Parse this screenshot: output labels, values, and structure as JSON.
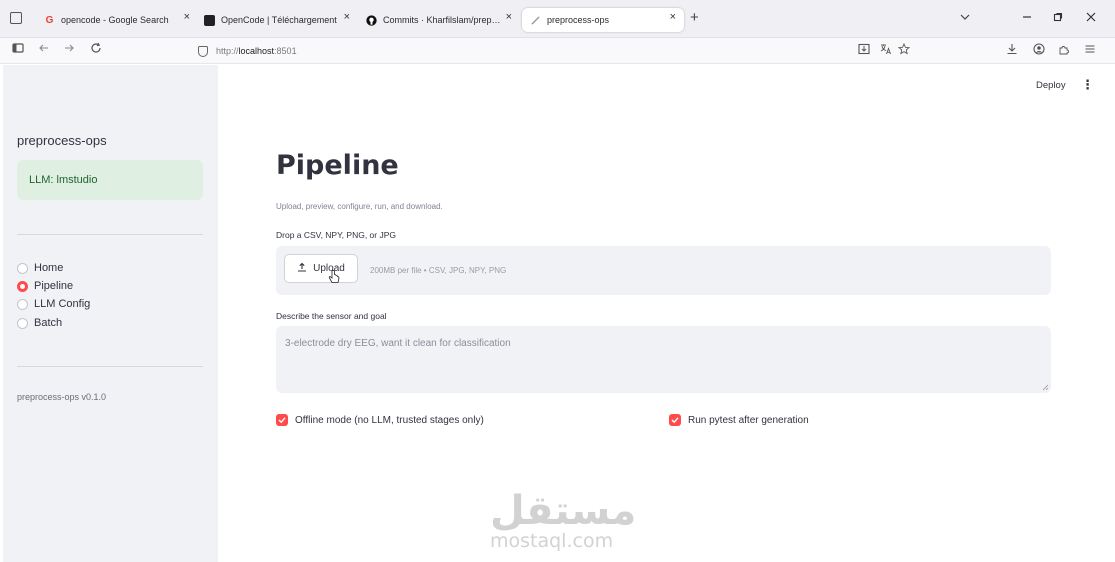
{
  "browser": {
    "tabs": [
      {
        "label": "opencode - Google Search",
        "favicon": "google-icon",
        "favicon_text": "G",
        "active": false
      },
      {
        "label": "OpenCode | Téléchargement",
        "favicon": "opencode-icon",
        "favicon_text": "",
        "active": false
      },
      {
        "label": "Commits · Kharfilslam/preprocess-ops",
        "favicon": "github-icon",
        "favicon_text": "",
        "active": false
      },
      {
        "label": "preprocess-ops",
        "favicon": "streamlit-icon",
        "favicon_text": "",
        "active": true
      }
    ],
    "close_glyph": "×",
    "new_tab": "+",
    "url_prefix": "http://",
    "url_host": "localhost",
    "url_port": ":8501"
  },
  "sidebar": {
    "title": "preprocess-ops",
    "llm_status": "LLM: lmstudio",
    "nav": [
      {
        "label": "Home",
        "selected": false
      },
      {
        "label": "Pipeline",
        "selected": true
      },
      {
        "label": "LLM Config",
        "selected": false
      },
      {
        "label": "Batch",
        "selected": false
      }
    ],
    "version": "preprocess-ops v0.1.0"
  },
  "header": {
    "deploy_label": "Deploy",
    "menu_glyph": "⋮"
  },
  "main": {
    "title": "Pipeline",
    "caption": "Upload, preview, configure, run, and download.",
    "upload_label": "Drop a CSV, NPY, PNG, or JPG",
    "upload_button": "Upload",
    "upload_limit": "200MB per file • CSV, JPG, NPY, PNG",
    "describe_label": "Describe the sensor and goal",
    "describe_placeholder": "3-electrode dry EEG, want it clean for classification",
    "offline_mode": {
      "label": "Offline mode (no LLM, trusted stages only)",
      "checked": true
    },
    "run_pytest": {
      "label": "Run pytest after generation",
      "checked": true
    }
  },
  "watermark": {
    "arabic": "مستقل",
    "latin": "mostaql.com"
  },
  "colors": {
    "accent": "#ff4b4b",
    "sidebar_bg": "#f0f2f6",
    "success_bg": "#dff0e3",
    "success_text": "#20652f"
  }
}
